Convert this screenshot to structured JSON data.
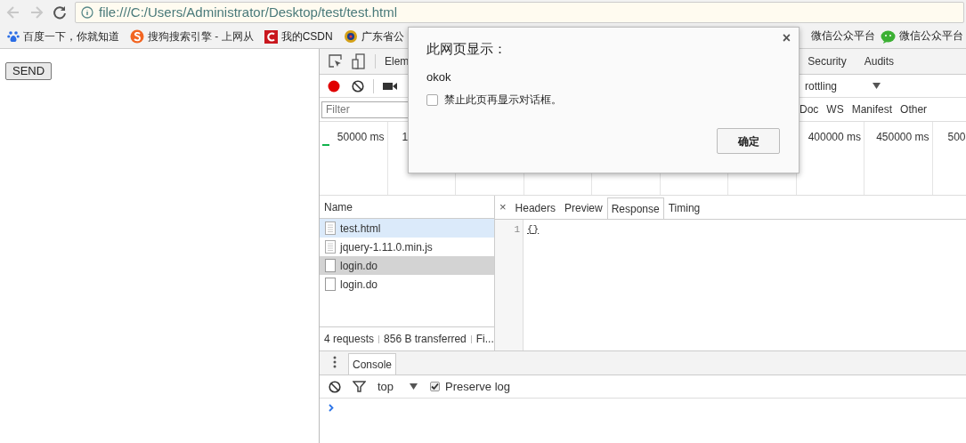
{
  "address_bar": {
    "back": {
      "disabled": true
    },
    "forward": {
      "disabled": true
    },
    "url": "file:///C:/Users/Administrator/Desktop/test/test.html"
  },
  "bookmarks": [
    {
      "label": "百度一下，你就知道",
      "kind": "paw"
    },
    {
      "label": "搜狗搜索引擎 - 上网从",
      "kind": "sogou"
    },
    {
      "label": "我的CSDN",
      "kind": "csdn"
    },
    {
      "label": "广东省公",
      "kind": "badge"
    },
    {
      "label": "微信公众平台",
      "kind": "none"
    },
    {
      "label": "微信公众平台",
      "kind": "wechat"
    }
  ],
  "page": {
    "button": "SEND"
  },
  "devtools": {
    "panel_tabs": [
      "Elem",
      "Security",
      "Audits"
    ],
    "recording": true,
    "throttling": "rottling",
    "filter": {
      "placeholder": "Filter"
    },
    "type_filters": [
      "Doc",
      "WS",
      "Manifest",
      "Other"
    ],
    "timeline_ticks": [
      "50000 ms",
      "1",
      "400000 ms",
      "450000 ms",
      "500"
    ],
    "name_header": "Name",
    "requests": [
      {
        "name": "test.html",
        "kind": "document",
        "selected": true,
        "hovered": false
      },
      {
        "name": "jquery-1.11.0.min.js",
        "kind": "document",
        "selected": false,
        "hovered": false
      },
      {
        "name": "login.do",
        "kind": "blank",
        "selected": false,
        "hovered": true
      },
      {
        "name": "login.do",
        "kind": "blank",
        "selected": false,
        "hovered": false
      }
    ],
    "summary": [
      "4 requests",
      "856 B transferred",
      "Fi..."
    ],
    "detail_close": "×",
    "detail_tabs": [
      {
        "label": "Headers",
        "selected": false
      },
      {
        "label": "Preview",
        "selected": false
      },
      {
        "label": "Response",
        "selected": true
      },
      {
        "label": "Timing",
        "selected": false
      }
    ],
    "response_lines": [
      {
        "number": "1",
        "text": "{}"
      }
    ],
    "drawer_tabs": [
      {
        "label": "Console",
        "selected": true
      }
    ],
    "context": "top",
    "preserve_log": {
      "label": "Preserve log",
      "checked": true
    }
  },
  "dialog": {
    "title": "此网页显示：",
    "close": "×",
    "message": "okok",
    "suppress": {
      "label": "禁止此页再显示对话框。",
      "checked": false
    },
    "button": "确定"
  }
}
